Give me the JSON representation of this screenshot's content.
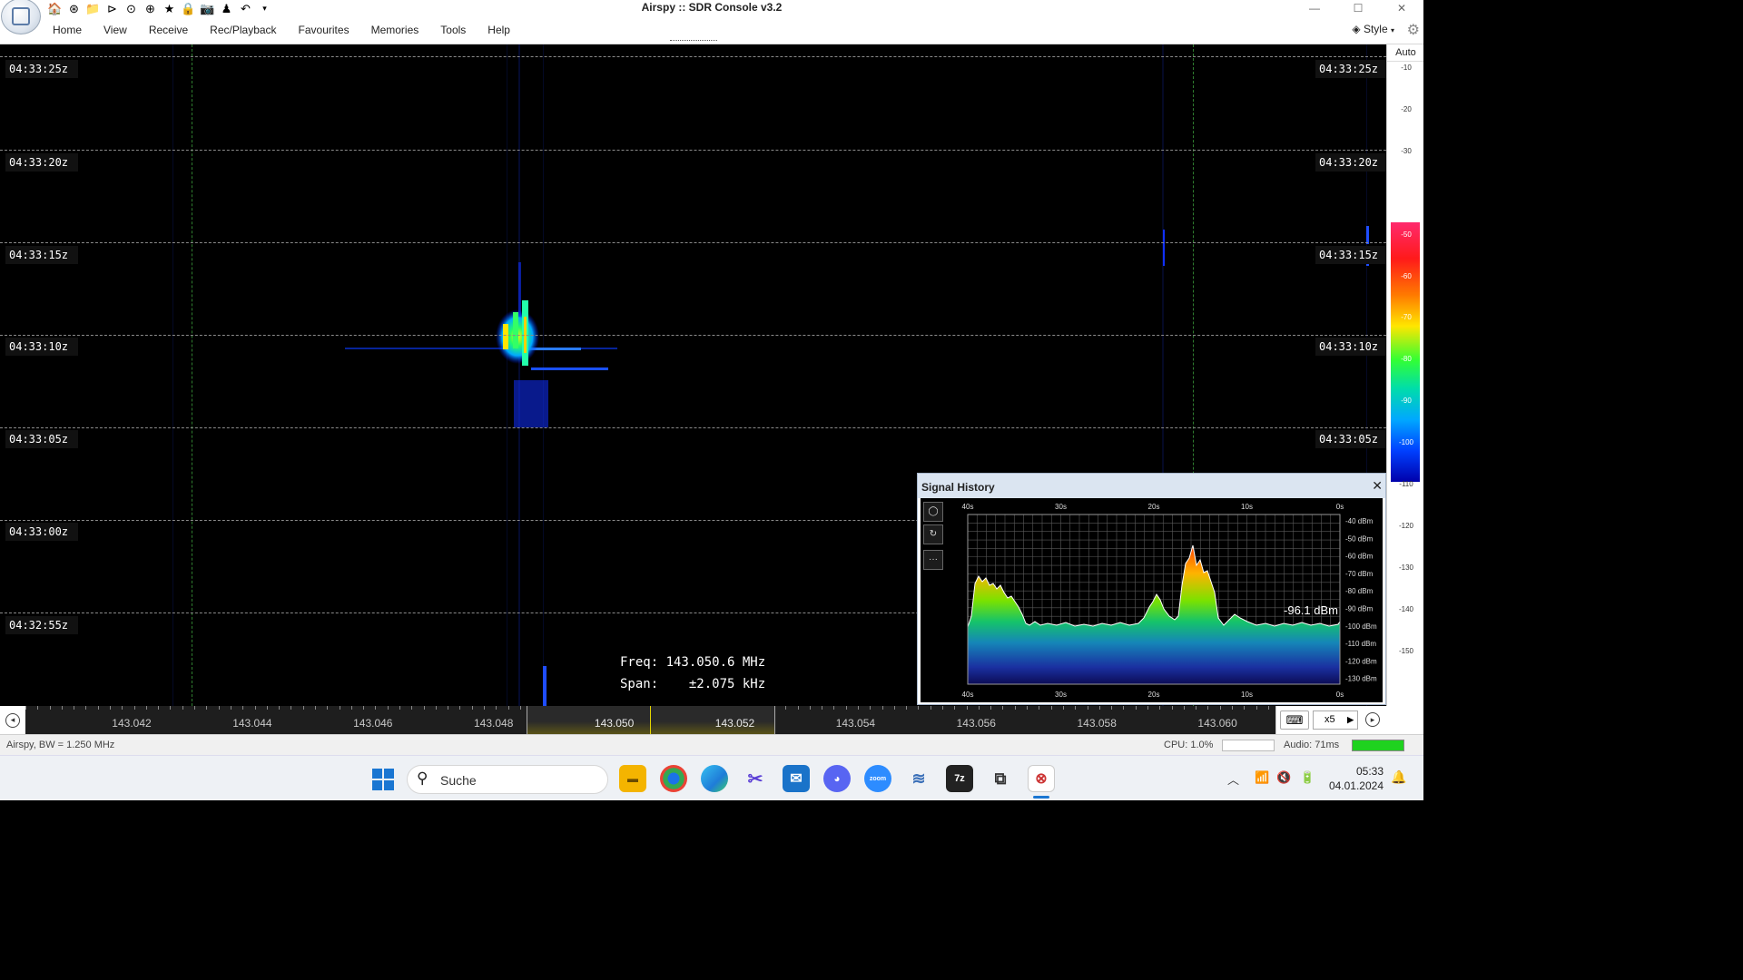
{
  "window": {
    "title": "Airspy :: SDR Console v3.2"
  },
  "menu": {
    "items": [
      "Home",
      "View",
      "Receive",
      "Rec/Playback",
      "Favourites",
      "Memories",
      "Tools",
      "Help"
    ],
    "style_label": "Style"
  },
  "waterfall": {
    "time_labels": [
      "04:33:25z",
      "04:33:20z",
      "04:33:15z",
      "04:33:10z",
      "04:33:05z",
      "04:33:00z",
      "04:32:55z"
    ],
    "freq_line": "Freq: 143.050.6 MHz",
    "span_line": "Span:    ±2.075 kHz"
  },
  "scale": {
    "mode": "Auto",
    "ticks": [
      "-10",
      "-20",
      "-30",
      "-40",
      "-50",
      "-60",
      "-70",
      "-80",
      "-90",
      "-100",
      "-110",
      "-120",
      "-130",
      "-140",
      "-150"
    ]
  },
  "frequency_ruler": {
    "labels": [
      "143.042",
      "143.044",
      "143.046",
      "143.048",
      "143.050",
      "143.052",
      "143.054",
      "143.056",
      "143.058",
      "143.060"
    ],
    "zoom_label": "x5"
  },
  "signal_history": {
    "title": "Signal History",
    "x_labels": [
      "40s",
      "30s",
      "20s",
      "10s",
      "0s"
    ],
    "y_labels": [
      "-40 dBm",
      "-50 dBm",
      "-60 dBm",
      "-70 dBm",
      "-80 dBm",
      "-90 dBm",
      "-100 dBm",
      "-110 dBm",
      "-120 dBm",
      "-130 dBm"
    ],
    "current_value": "-96.1 dBm"
  },
  "status": {
    "device": "Airspy, BW = 1.250 MHz",
    "cpu": "CPU: 1.0%",
    "audio": "Audio: 71ms"
  },
  "taskbar": {
    "search_placeholder": "Suche",
    "time": "05:33",
    "date": "04.01.2024",
    "apps": [
      "file-explorer",
      "chrome",
      "edge",
      "snipping-tool",
      "mail",
      "discord",
      "zoom",
      "app-blue",
      "7zip",
      "remote-desktop",
      "sdr-console"
    ]
  },
  "colors": {
    "accent": "#1a76d2",
    "marker": "#e3d400",
    "gridline": "#8a8a8a"
  }
}
